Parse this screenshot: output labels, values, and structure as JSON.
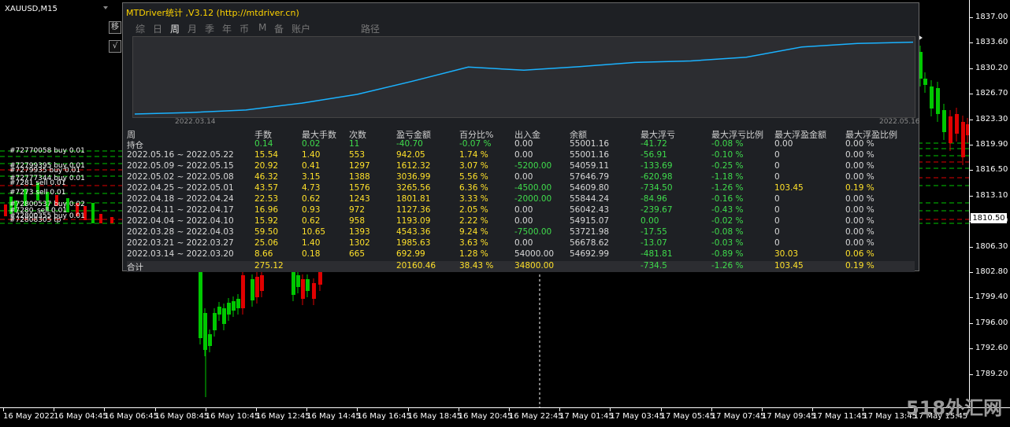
{
  "chart": {
    "symbol": "XAUUSD,M15",
    "current_price": "1810.50",
    "price_ticks": [
      "1837.00",
      "1833.60",
      "1830.20",
      "1826.70",
      "1823.30",
      "1819.90",
      "1816.50",
      "1813.10",
      "1809.70",
      "1806.30",
      "1802.80",
      "1799.40",
      "1796.00",
      "1792.60",
      "1789.20"
    ],
    "time_ticks": [
      "16 May 2022",
      "16 May 04:45",
      "16 May 06:45",
      "16 May 08:45",
      "16 May 10:45",
      "16 May 12:45",
      "16 May 14:45",
      "16 May 16:45",
      "16 May 18:45",
      "16 May 20:45",
      "16 May 22:45",
      "17 May 01:45",
      "17 May 03:45",
      "17 May 05:45",
      "17 May 07:45",
      "17 May 09:45",
      "17 May 11:45",
      "17 May 13:45",
      "17 May 15:45"
    ],
    "side_buttons": [
      "移",
      "√"
    ],
    "orders": [
      "#72770058 buy 0.01",
      "#72799395 buy 0.01",
      "#7279935 buy 0.01",
      "#72777344 buy 0.01",
      "#7281 sell 0.01",
      "#7273 sell 0.01",
      "#72800537 buy 0.02",
      "#7280_sell 0.01",
      "#72800355 buy 0.01",
      "#72808305 tp"
    ]
  },
  "panel": {
    "title": "MTDriver统计 ,V3.12 (http://mtdriver.cn)",
    "tabs": [
      "综",
      "日",
      "周",
      "月",
      "季",
      "年",
      "币",
      "M",
      "备",
      "账户",
      "路径"
    ],
    "active_tab": "周",
    "plot_start": "2022.03.14",
    "plot_end": "2022.05.16",
    "equity_curve": [
      0,
      1.2,
      3.2,
      8.6,
      15.6,
      26.1,
      37.3,
      34.8,
      37.7,
      41.0,
      42.2,
      45.2,
      53.3,
      56.1,
      57.1
    ],
    "headers": [
      "周",
      "手数",
      "最大手数",
      "次数",
      "盈亏金额",
      "百分比%",
      "出入金",
      "余额",
      "最大浮亏",
      "最大浮亏比例",
      "最大浮盈金额",
      "最大浮盈比例"
    ],
    "holding": [
      "持仓",
      "0.14",
      "0.02",
      "11",
      "-40.70",
      "-0.07 %",
      "0.00",
      "55001.16",
      "-41.72",
      "-0.08 %",
      "0.00",
      "0.00 %"
    ],
    "rows": [
      [
        "2022.05.16 ~ 2022.05.22",
        "15.54",
        "1.40",
        "553",
        "942.05",
        "1.74 %",
        "0.00",
        "55001.16",
        "-56.91",
        "-0.10 %",
        "0",
        "0.00 %"
      ],
      [
        "2022.05.09 ~ 2022.05.15",
        "20.92",
        "0.41",
        "1297",
        "1612.32",
        "3.07 %",
        "-5200.00",
        "54059.11",
        "-133.69",
        "-0.25 %",
        "0",
        "0.00 %"
      ],
      [
        "2022.05.02 ~ 2022.05.08",
        "46.32",
        "3.15",
        "1388",
        "3036.99",
        "5.56 %",
        "0.00",
        "57646.79",
        "-620.98",
        "-1.18 %",
        "0",
        "0.00 %"
      ],
      [
        "2022.04.25 ~ 2022.05.01",
        "43.57",
        "4.73",
        "1576",
        "3265.56",
        "6.36 %",
        "-4500.00",
        "54609.80",
        "-734.50",
        "-1.26 %",
        "103.45",
        "0.19 %"
      ],
      [
        "2022.04.18 ~ 2022.04.24",
        "22.53",
        "0.62",
        "1243",
        "1801.81",
        "3.33 %",
        "-2000.00",
        "55844.24",
        "-84.96",
        "-0.16 %",
        "0",
        "0.00 %"
      ],
      [
        "2022.04.11 ~ 2022.04.17",
        "16.96",
        "0.93",
        "972",
        "1127.36",
        "2.05 %",
        "0.00",
        "56042.43",
        "-239.67",
        "-0.43 %",
        "0",
        "0.00 %"
      ],
      [
        "2022.04.04 ~ 2022.04.10",
        "15.92",
        "0.62",
        "958",
        "1193.09",
        "2.22 %",
        "0.00",
        "54915.07",
        "0.00",
        "-0.02 %",
        "0",
        "0.00 %"
      ],
      [
        "2022.03.28 ~ 2022.04.03",
        "59.50",
        "10.65",
        "1393",
        "4543.36",
        "9.24 %",
        "-7500.00",
        "53721.98",
        "-17.55",
        "-0.08 %",
        "0",
        "0.00 %"
      ],
      [
        "2022.03.21 ~ 2022.03.27",
        "25.06",
        "1.40",
        "1302",
        "1985.63",
        "3.63 %",
        "0.00",
        "56678.62",
        "-13.07",
        "-0.03 %",
        "0",
        "0.00 %"
      ],
      [
        "2022.03.14 ~ 2022.03.20",
        "8.66",
        "0.18",
        "665",
        "692.99",
        "1.28 %",
        "54000.00",
        "54692.99",
        "-481.81",
        "-0.89 %",
        "30.03",
        "0.06 %"
      ]
    ],
    "total": [
      "合计",
      "275.12",
      "",
      "",
      "20160.46",
      "38.43 %",
      "34800.00",
      "",
      "-734.5",
      "-1.26 %",
      "103.45",
      "0.19 %"
    ]
  },
  "watermark": "518外汇网",
  "colors": {
    "bull": "#00c800",
    "bear": "#e00000",
    "equity_line": "#1ab2ff",
    "title": "#ffd400",
    "value_yellow": "#ffe12a",
    "value_green": "#3fdc4c"
  }
}
